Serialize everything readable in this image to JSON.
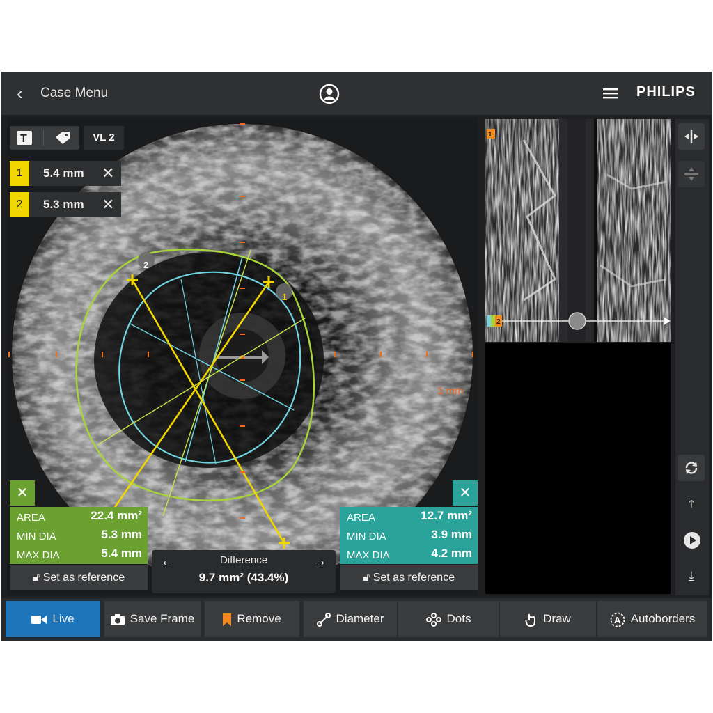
{
  "header": {
    "back_label": "Case Menu",
    "brand": "PHILIPS"
  },
  "viewer": {
    "tool_text_icon": "T",
    "vessel_label": "VL 2",
    "scale_label": "1 mm",
    "measurements": [
      {
        "index": "1",
        "value": "5.4 mm"
      },
      {
        "index": "2",
        "value": "5.3 mm"
      }
    ],
    "marker_labels": [
      "2",
      "1"
    ]
  },
  "left_panel": {
    "color": "#6aa130",
    "rows": [
      {
        "label": "AREA",
        "value": "22.4 mm²"
      },
      {
        "label": "MIN DIA",
        "value": "5.3 mm"
      },
      {
        "label": "MAX DIA",
        "value": "5.4 mm"
      }
    ],
    "reference_label": "Set as reference"
  },
  "right_panel": {
    "color": "#2aa39a",
    "rows": [
      {
        "label": "AREA",
        "value": "12.7 mm²"
      },
      {
        "label": "MIN DIA",
        "value": "3.9 mm"
      },
      {
        "label": "MAX DIA",
        "value": "4.2 mm"
      }
    ],
    "reference_label": "Set as reference"
  },
  "difference": {
    "title": "Difference",
    "value": "9.7 mm² (43.4%)"
  },
  "longitudinal": {
    "markers": [
      "1",
      "2"
    ]
  },
  "toolbar": {
    "live": "Live",
    "save_frame": "Save Frame",
    "remove": "Remove",
    "diameter": "Diameter",
    "dots": "Dots",
    "draw": "Draw",
    "autoborders": "Autoborders"
  },
  "colors": {
    "live_accent": "#1e74b8",
    "measure_yellow": "#f2d600",
    "outer_border": "#a8d43a",
    "inner_border": "#6fd3e0",
    "scale_orange": "#f26b1d"
  }
}
